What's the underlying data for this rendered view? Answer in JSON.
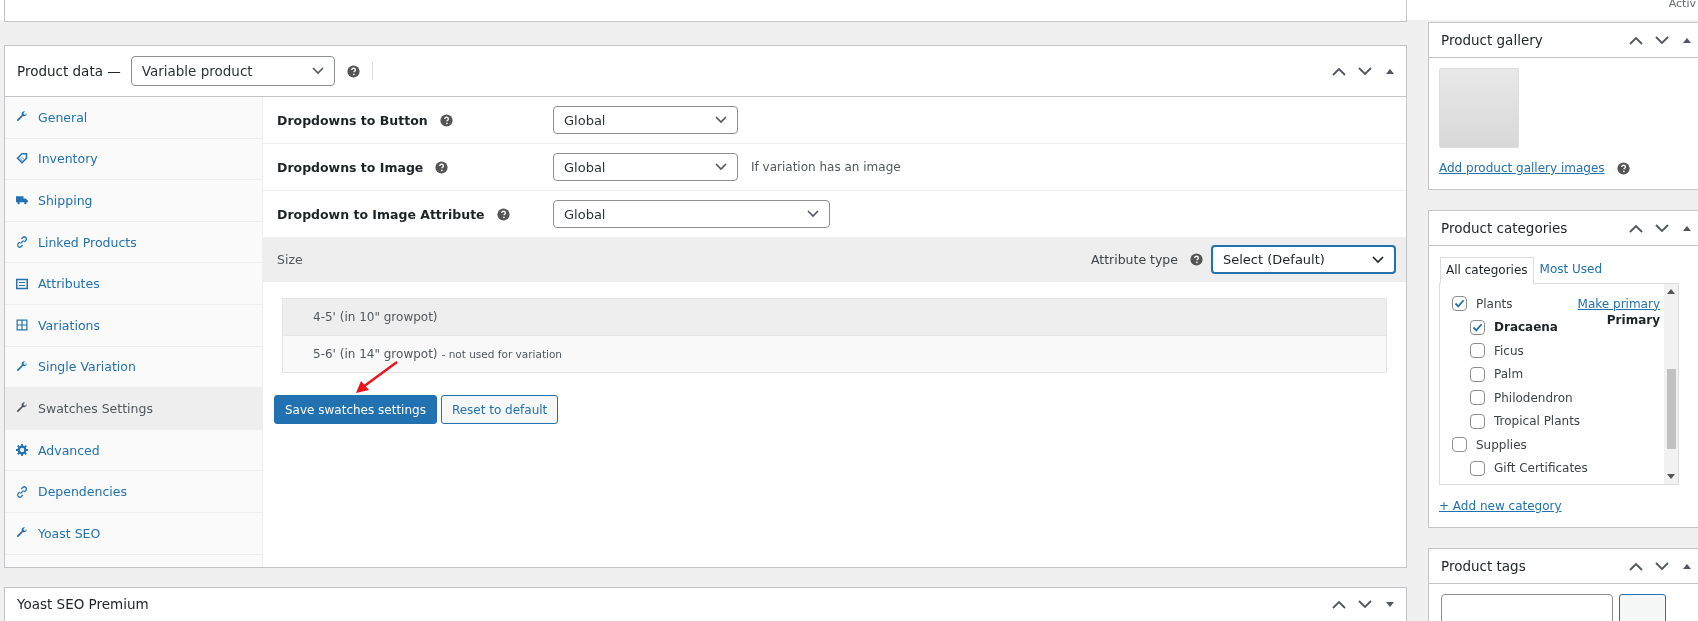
{
  "top_bar": {
    "corner_text": "Activ"
  },
  "product_data": {
    "title": "Product data —",
    "type_select": {
      "value": "Variable product"
    },
    "tabs": [
      {
        "label": "General",
        "kind": "wrench",
        "selected": false
      },
      {
        "label": "Inventory",
        "kind": "tag",
        "selected": false
      },
      {
        "label": "Shipping",
        "kind": "truck",
        "selected": false
      },
      {
        "label": "Linked Products",
        "kind": "link",
        "selected": false
      },
      {
        "label": "Attributes",
        "kind": "list",
        "selected": false
      },
      {
        "label": "Variations",
        "kind": "grid",
        "selected": false
      },
      {
        "label": "Single Variation",
        "kind": "wrench",
        "selected": false
      },
      {
        "label": "Swatches Settings",
        "kind": "wrench",
        "selected": true
      },
      {
        "label": "Advanced",
        "kind": "gear",
        "selected": false
      },
      {
        "label": "Dependencies",
        "kind": "link",
        "selected": false
      },
      {
        "label": "Yoast SEO",
        "kind": "wrench",
        "selected": false
      }
    ],
    "settings": [
      {
        "label": "Dropdowns to Button",
        "value": "Global",
        "wide": false
      },
      {
        "label": "Dropdowns to Image",
        "value": "Global",
        "wide": false,
        "hint": "If variation has an image"
      },
      {
        "label": "Dropdown to Image Attribute",
        "value": "Global",
        "wide": true
      }
    ],
    "attribute": {
      "name": "Size",
      "type_label": "Attribute type",
      "type_value": "Select (Default)"
    },
    "terms": [
      {
        "name": "4-5' (in 10\" growpot)"
      },
      {
        "name": "5-6' (in 14\" growpot)",
        "note": "- not used for variation"
      }
    ],
    "buttons": [
      {
        "label": "Save swatches settings",
        "kind": "primary"
      },
      {
        "label": "Reset to default",
        "kind": "secondary"
      }
    ]
  },
  "yoast_box": {
    "title": "Yoast SEO Premium"
  },
  "product_gallery": {
    "title": "Product gallery",
    "add_link": "Add product gallery images"
  },
  "product_categories": {
    "title": "Product categories",
    "tabs": [
      {
        "label": "All categories",
        "selected": true
      },
      {
        "label": "Most Used",
        "selected": false
      }
    ],
    "items": [
      {
        "name": "Plants",
        "checked": true,
        "make_primary": "Make primary",
        "children": [
          {
            "name": "Dracaena",
            "checked": true,
            "primary_label": "Primary"
          },
          {
            "name": "Ficus",
            "checked": false
          },
          {
            "name": "Palm",
            "checked": false
          },
          {
            "name": "Philodendron",
            "checked": false
          },
          {
            "name": "Tropical Plants",
            "checked": false
          }
        ]
      },
      {
        "name": "Supplies",
        "checked": false,
        "children": [
          {
            "name": "Gift Certificates",
            "checked": false
          }
        ]
      }
    ],
    "add_link": "+ Add new category"
  },
  "product_tags": {
    "title": "Product tags"
  }
}
